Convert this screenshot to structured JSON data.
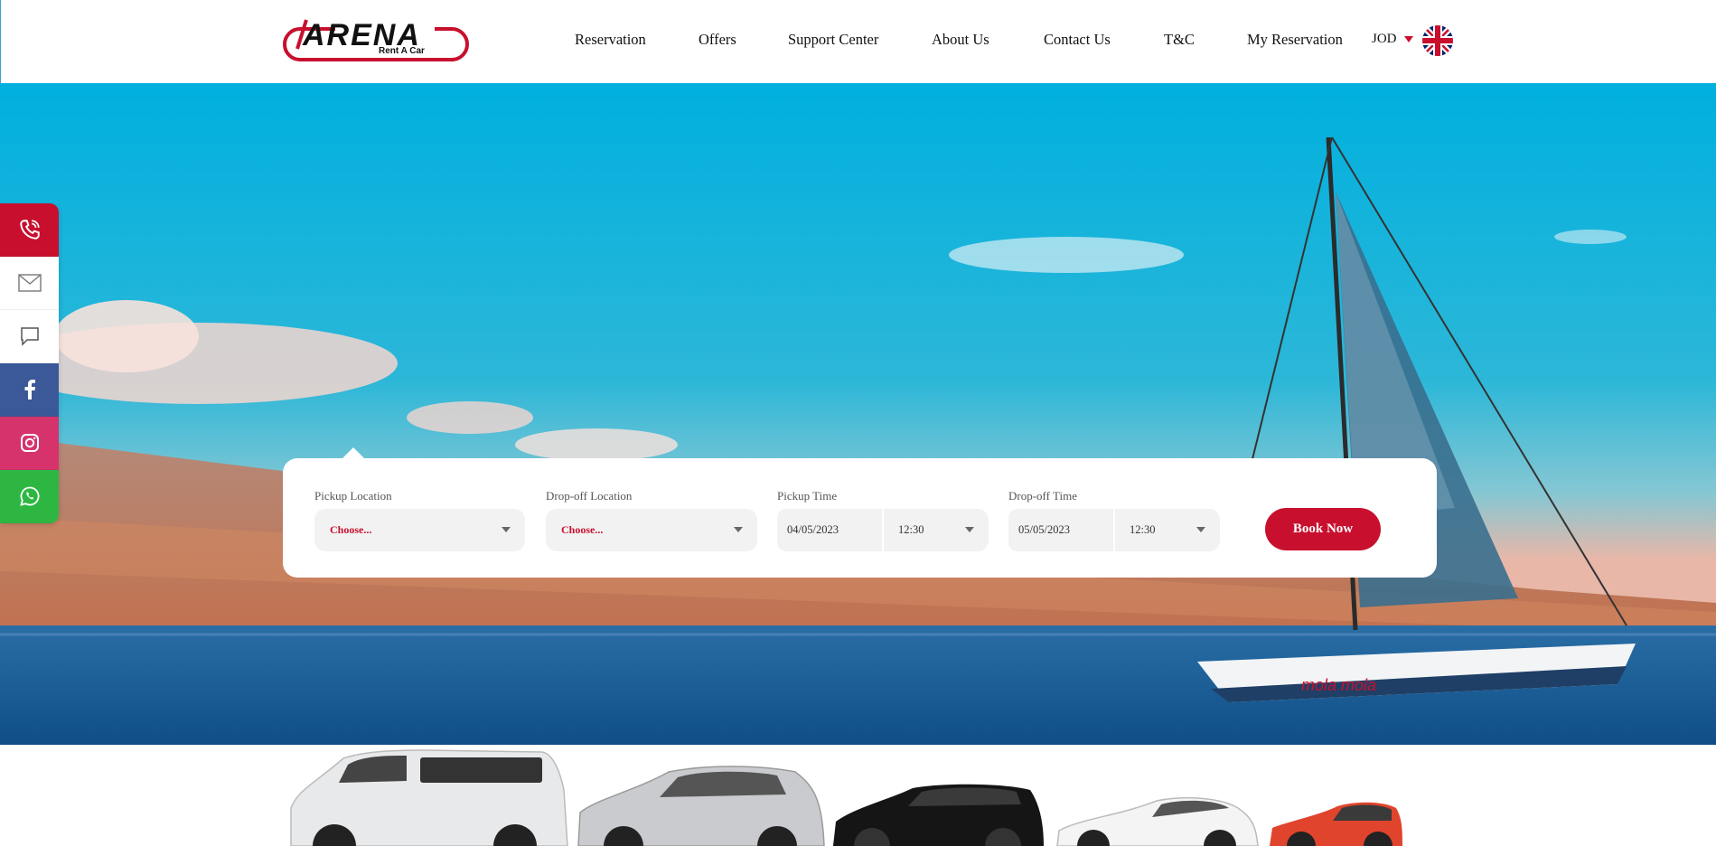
{
  "brand": {
    "name": "ARENA",
    "tagline": "Rent A Car",
    "accent_color": "#c8102e"
  },
  "nav": {
    "items": [
      {
        "label": "Reservation"
      },
      {
        "label": "Offers"
      },
      {
        "label": "Support Center"
      },
      {
        "label": "About Us"
      },
      {
        "label": "Contact Us"
      },
      {
        "label": "T&C"
      },
      {
        "label": "My Reservation"
      }
    ],
    "currency": "JOD",
    "language_icon": "uk-flag-icon"
  },
  "social": [
    {
      "icon": "phone-icon",
      "color": "#c8102e"
    },
    {
      "icon": "mail-icon",
      "color": "#ffffff"
    },
    {
      "icon": "chat-icon",
      "color": "#ffffff"
    },
    {
      "icon": "facebook-icon",
      "color": "#3b5998"
    },
    {
      "icon": "instagram-icon",
      "color": "#d6336c"
    },
    {
      "icon": "whatsapp-icon",
      "color": "#2db742"
    }
  ],
  "booking": {
    "pickup_location": {
      "label": "Pickup Location",
      "value": "Choose..."
    },
    "dropoff_location": {
      "label": "Drop-off Location",
      "value": "Choose..."
    },
    "pickup_time": {
      "label": "Pickup Time",
      "date": "04/05/2023",
      "time": "12:30"
    },
    "dropoff_time": {
      "label": "Drop-off Time",
      "date": "05/05/2023",
      "time": "12:30"
    },
    "submit_label": "Book Now"
  },
  "hero": {
    "boat_text": "mola mola"
  }
}
